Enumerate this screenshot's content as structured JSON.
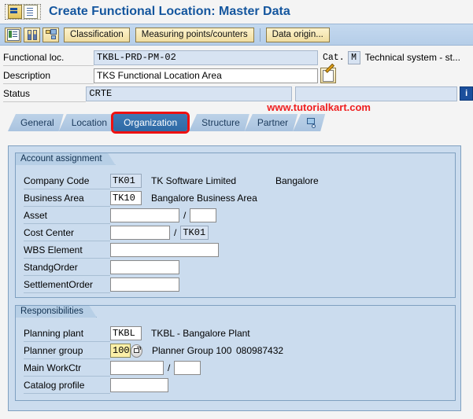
{
  "window": {
    "title": "Create Functional Location: Master Data",
    "sys_icons": [
      "sap-menu-icon",
      "document-icon"
    ]
  },
  "toolbar": {
    "icon_buttons": [
      {
        "name": "list-display-icon",
        "tooltip": "List"
      },
      {
        "name": "partners-icon",
        "tooltip": "Partners"
      },
      {
        "name": "structure-icon",
        "tooltip": "Structure"
      }
    ],
    "buttons": [
      {
        "label": "Classification"
      },
      {
        "label": "Measuring points/counters"
      },
      {
        "label": "Data origin..."
      }
    ]
  },
  "header": {
    "functional_loc": {
      "label": "Functional loc.",
      "value": "TKBL-PRD-PM-02"
    },
    "cat": {
      "label": "Cat.",
      "value": "M",
      "text": "Technical system - st..."
    },
    "description": {
      "label": "Description",
      "value": "TKS Functional Location Area",
      "edit_icon": "long-text-edit-icon"
    },
    "status": {
      "label": "Status",
      "value": "CRTE",
      "value2": "",
      "info_icon": "info-icon"
    }
  },
  "watermark": "www.tutorialkart.com",
  "tabs": [
    {
      "label": "General",
      "active": false
    },
    {
      "label": "Location",
      "active": false
    },
    {
      "label": "Organization",
      "active": true
    },
    {
      "label": "Structure",
      "active": false
    },
    {
      "label": "Partner",
      "active": false
    },
    {
      "label": "",
      "active": false,
      "icon": "more-tabs-icon"
    }
  ],
  "account_assignment": {
    "title": "Account assignment",
    "rows": {
      "company_code": {
        "label": "Company Code",
        "value": "TK01",
        "text": "TK Software Limited",
        "text2": "Bangalore"
      },
      "business_area": {
        "label": "Business Area",
        "value": "TK10",
        "text": "Bangalore Business Area"
      },
      "asset": {
        "label": "Asset",
        "value": "",
        "value2": "",
        "separator": "/"
      },
      "cost_center": {
        "label": "Cost Center",
        "value": "",
        "value2": "TK01",
        "separator": "/"
      },
      "wbs_element": {
        "label": "WBS Element",
        "value": ""
      },
      "standing_order": {
        "label": "StandgOrder",
        "value": ""
      },
      "settlement_order": {
        "label": "SettlementOrder",
        "value": ""
      }
    }
  },
  "responsibilities": {
    "title": "Responsibilities",
    "rows": {
      "planning_plant": {
        "label": "Planning plant",
        "value": "TKBL",
        "text": "TKBL - Bangalore Plant"
      },
      "planner_group": {
        "label": "Planner group",
        "value": "100",
        "text": "Planner Group 100",
        "text2": "080987432",
        "f4_icon": "search-help-icon"
      },
      "main_workctr": {
        "label": "Main WorkCtr",
        "value": "",
        "value2": "",
        "separator": "/"
      },
      "catalog_profile": {
        "label": "Catalog profile",
        "value": ""
      }
    }
  },
  "colors": {
    "title_blue": "#14569e",
    "toolbar_blue": "#b5cde8",
    "panel_blue": "#cbdcee",
    "active_tab": "#2f6aa5",
    "highlight_ring": "#ee1111",
    "watermark_red": "#ef1f1f",
    "button_tan": "#f0dda0",
    "required_yellow": "#fbf0a8"
  }
}
